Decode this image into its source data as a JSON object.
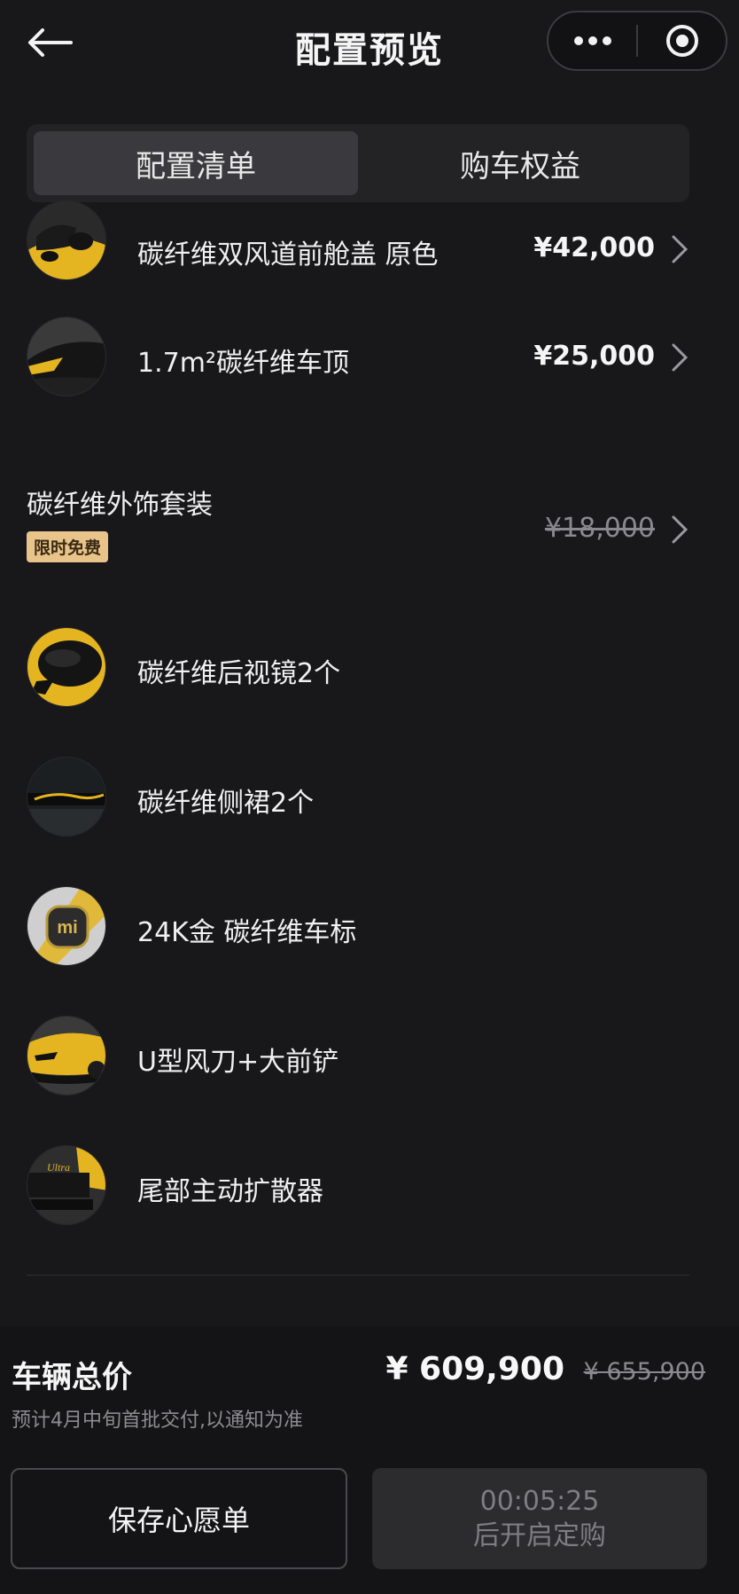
{
  "header": {
    "title": "配置预览",
    "back_icon": "arrow-left-icon",
    "more_icon": "more-dots-icon",
    "target_icon": "target-icon"
  },
  "tabs": [
    {
      "label": "配置清单",
      "active": true
    },
    {
      "label": "购车权益",
      "active": false
    }
  ],
  "items": [
    {
      "label": "碳纤维双风道前舱盖 原色",
      "price": "¥42,000",
      "thumb": "yellow-hood"
    },
    {
      "label": "1.7m²碳纤维车顶",
      "price": "¥25,000",
      "thumb": "carbon-roof"
    }
  ],
  "package": {
    "label": "碳纤维外饰套装",
    "badge": "限时免费",
    "price": "¥18,000",
    "sub_items": [
      {
        "label": "碳纤维后视镜2个",
        "thumb": "mirror"
      },
      {
        "label": "碳纤维侧裙2个",
        "thumb": "side-skirt"
      },
      {
        "label": "24K金 碳纤维车标",
        "thumb": "logo"
      },
      {
        "label": "U型风刀+大前铲",
        "thumb": "front-splitter"
      },
      {
        "label": "尾部主动扩散器",
        "thumb": "rear-diffuser"
      }
    ]
  },
  "footer": {
    "total_label": "车辆总价",
    "total_price": "¥ 609,900",
    "original_price": "¥ 655,900",
    "delivery_note": "预计4月中旬首批交付,以通知为准",
    "save_button": "保存心愿单",
    "countdown": "00:05:25",
    "order_button": "后开启定购"
  },
  "colors": {
    "background": "#18181b",
    "accent_yellow": "#f2c230",
    "badge_gold": "#e8c48a"
  }
}
